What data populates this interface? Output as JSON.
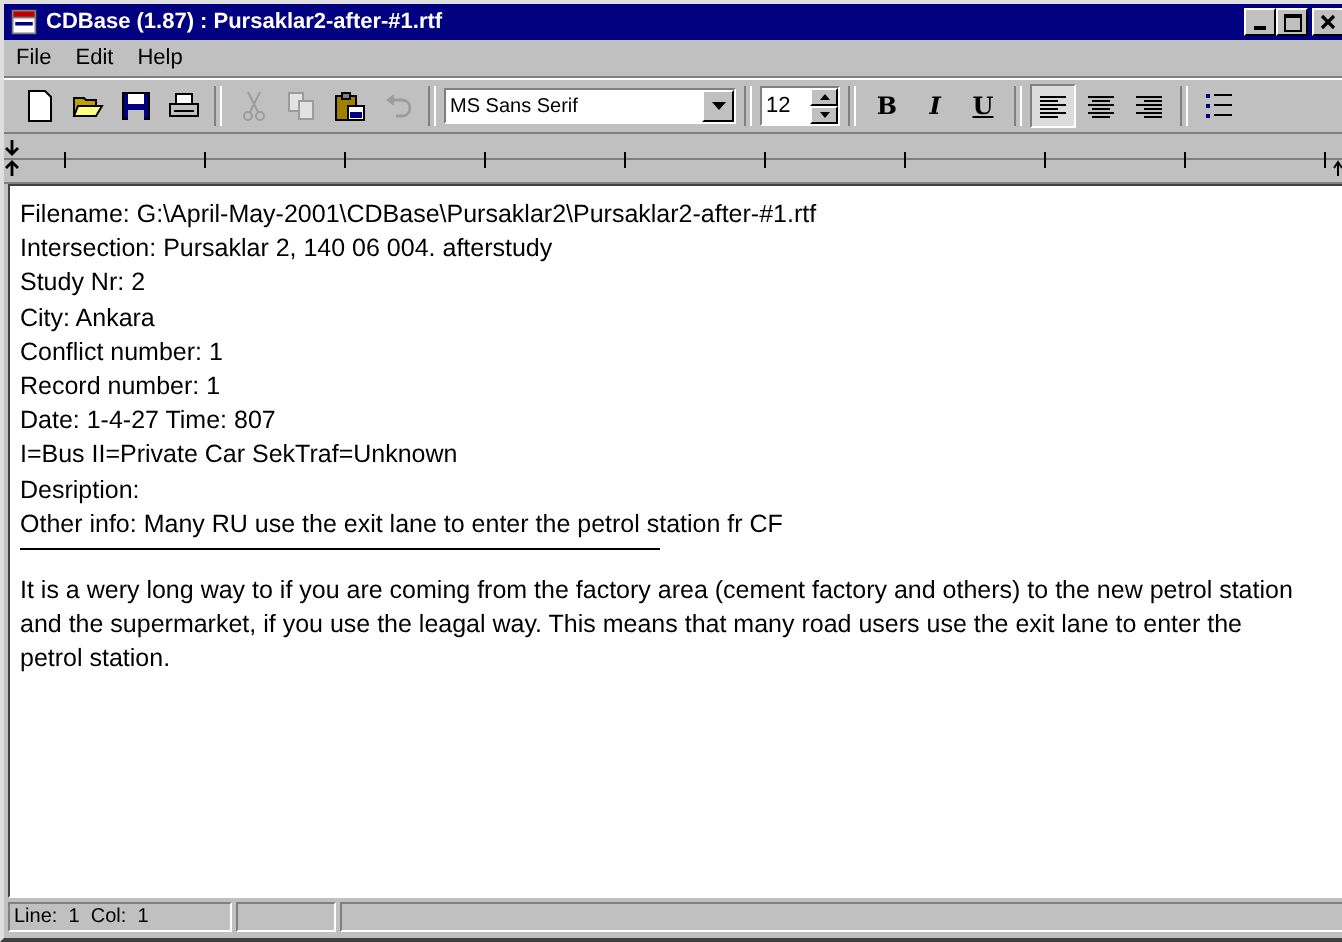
{
  "window": {
    "title": "CDBase (1.87) : Pursaklar2-after-#1.rtf"
  },
  "menu": [
    {
      "label": "File"
    },
    {
      "label": "Edit"
    },
    {
      "label": "Help"
    }
  ],
  "toolbar": {
    "file_buttons": [
      {
        "kind": "new",
        "disabled": false
      },
      {
        "kind": "open",
        "disabled": false
      },
      {
        "kind": "save",
        "disabled": false
      },
      {
        "kind": "print",
        "disabled": false
      }
    ],
    "edit_buttons": [
      {
        "kind": "cut",
        "disabled": true
      },
      {
        "kind": "copy",
        "disabled": true
      },
      {
        "kind": "paste",
        "disabled": false
      },
      {
        "kind": "undo",
        "disabled": true
      }
    ],
    "font": "MS Sans Serif",
    "size": "12",
    "format_buttons": [
      {
        "kind": "bold",
        "label": "B"
      },
      {
        "kind": "italic",
        "label": "I"
      },
      {
        "kind": "underline",
        "label": "U"
      }
    ],
    "align_buttons": [
      {
        "kind": "left",
        "selected": true
      },
      {
        "kind": "center",
        "selected": false
      },
      {
        "kind": "right",
        "selected": false
      }
    ]
  },
  "document": {
    "lines": [
      "Filename: G:\\April-May-2001\\CDBase\\Pursaklar2\\Pursaklar2-after-#1.rtf",
      "Intersection: Pursaklar 2, 140 06 004. afterstudy",
      "Study Nr: 2",
      "City: Ankara",
      "Conflict number: 1",
      "Record number: 1",
      "Date: 1-4-27   Time: 807",
      "I=Bus    II=Private Car    SekTraf=Unknown",
      "Desription:",
      "Other info: Many RU use the exit lane to enter the petrol station fr CF"
    ],
    "paragraph": "It is a wery long way to if you are coming from the factory area (cement factory and others) to the new petrol station and the supermarket, if you use the leagal way. This means that many road users use the exit lane to enter the petrol station."
  },
  "status_bar": {
    "position": "Line:  1  Col:  1"
  }
}
